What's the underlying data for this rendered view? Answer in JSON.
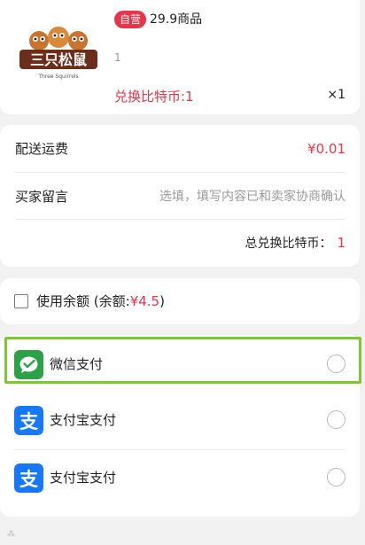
{
  "product": {
    "badge": "自营",
    "title": "29.9商品",
    "spec": "1",
    "price_label": "兑换比特币:1",
    "quantity": "×1",
    "logo_text": "三只松鼠",
    "logo_subtext": "Three Squirrels"
  },
  "summary": {
    "shipping_label": "配送运费",
    "shipping_value": "¥0.01",
    "message_label": "买家留言",
    "message_placeholder": "选填，填写内容已和卖家协商确认",
    "total_label": "总兑换比特币：",
    "total_value": "1"
  },
  "balance": {
    "label": "使用余额 (余额:",
    "amount": "¥4.5",
    "close": ")",
    "checked": false
  },
  "payment": {
    "options": [
      {
        "label": "微信支付",
        "icon": "wechat-pay-icon",
        "color": "#2ba245",
        "selected": false
      },
      {
        "label": "支付宝支付",
        "icon": "alipay-icon",
        "color": "#1677ff",
        "selected": false
      },
      {
        "label": "支付宝支付",
        "icon": "alipay-icon",
        "color": "#1677ff",
        "selected": false
      }
    ]
  },
  "colors": {
    "accent": "#e8334a",
    "highlight": "#7fc832"
  }
}
